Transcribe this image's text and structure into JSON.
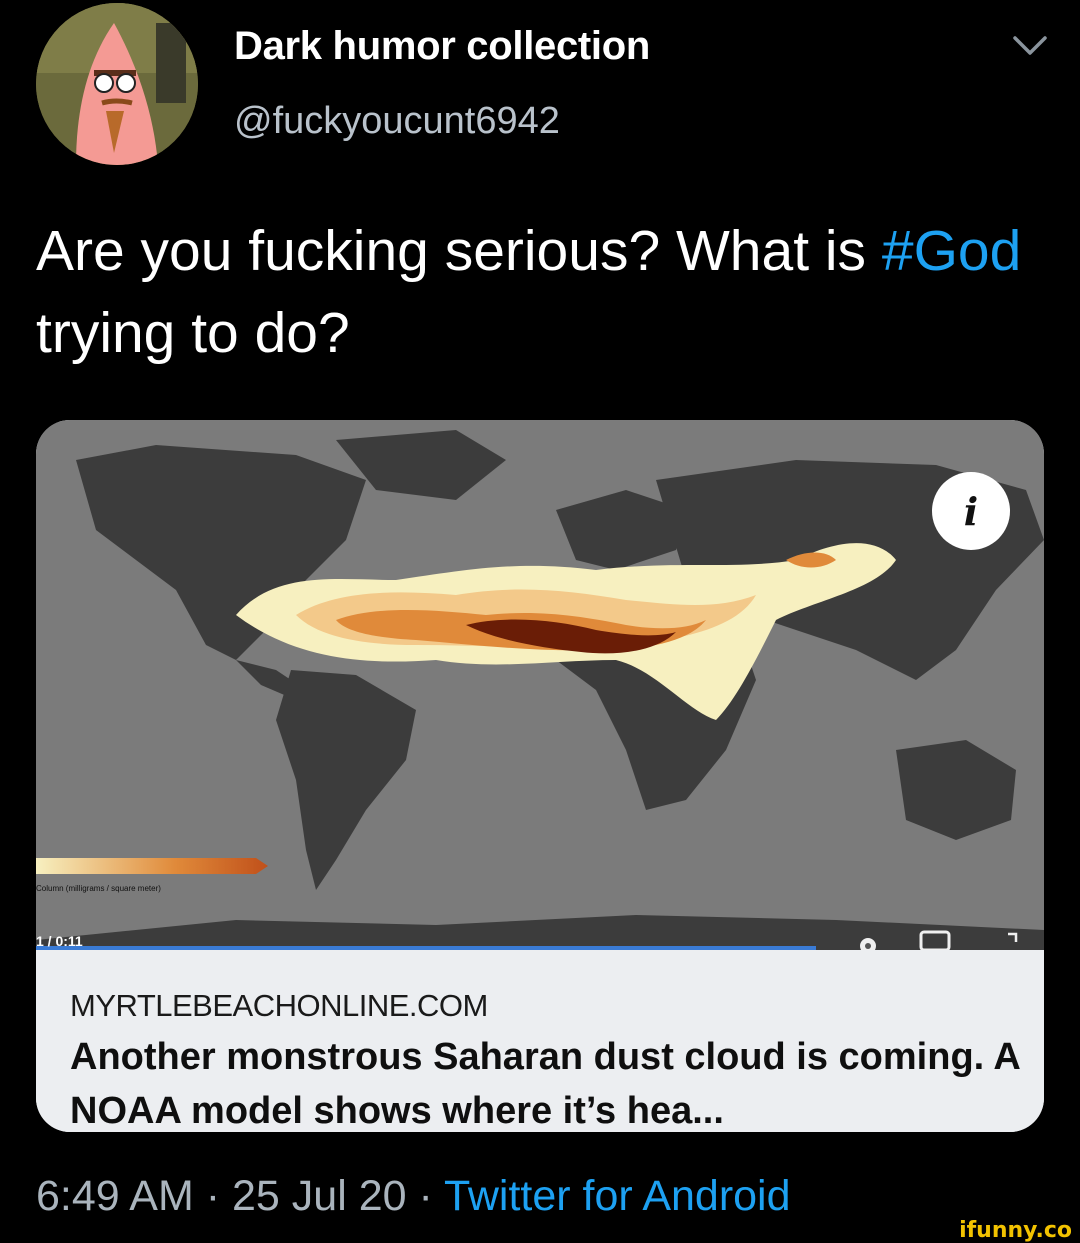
{
  "tweet": {
    "display_name": "Dark humor collection",
    "handle": "@fuckyoucunt6942",
    "text_before": "Are you fucking serious? What is ",
    "hashtag": "#God",
    "text_after": " trying to do?",
    "menu_icon": "chevron-down-icon",
    "avatar_icon": "avatar-image"
  },
  "media": {
    "info_glyph": "i",
    "player_progress": "1 / 0:11",
    "legend_label": "Column (milligrams / square meter)",
    "icons": [
      "gear-icon",
      "screen-icon",
      "expand-icon"
    ]
  },
  "card": {
    "domain": "MYRTLEBEACHONLINE.COM",
    "title": "Another monstrous Saharan dust cloud is coming. A NOAA model shows where it’s hea..."
  },
  "footer": {
    "time": "6:49 AM",
    "separator": "·",
    "date": "25 Jul 20",
    "source": "Twitter for Android"
  },
  "watermark": "ifunny.co",
  "colors": {
    "background": "#000000",
    "link": "#1da1f2",
    "handle": "#b9c2cb",
    "ocean": "#7b7b7b",
    "land": "#3c3c3c",
    "dust_light": "#f7f0c0",
    "dust_mid": "#e08a3a",
    "dust_dark": "#6a1d06"
  }
}
